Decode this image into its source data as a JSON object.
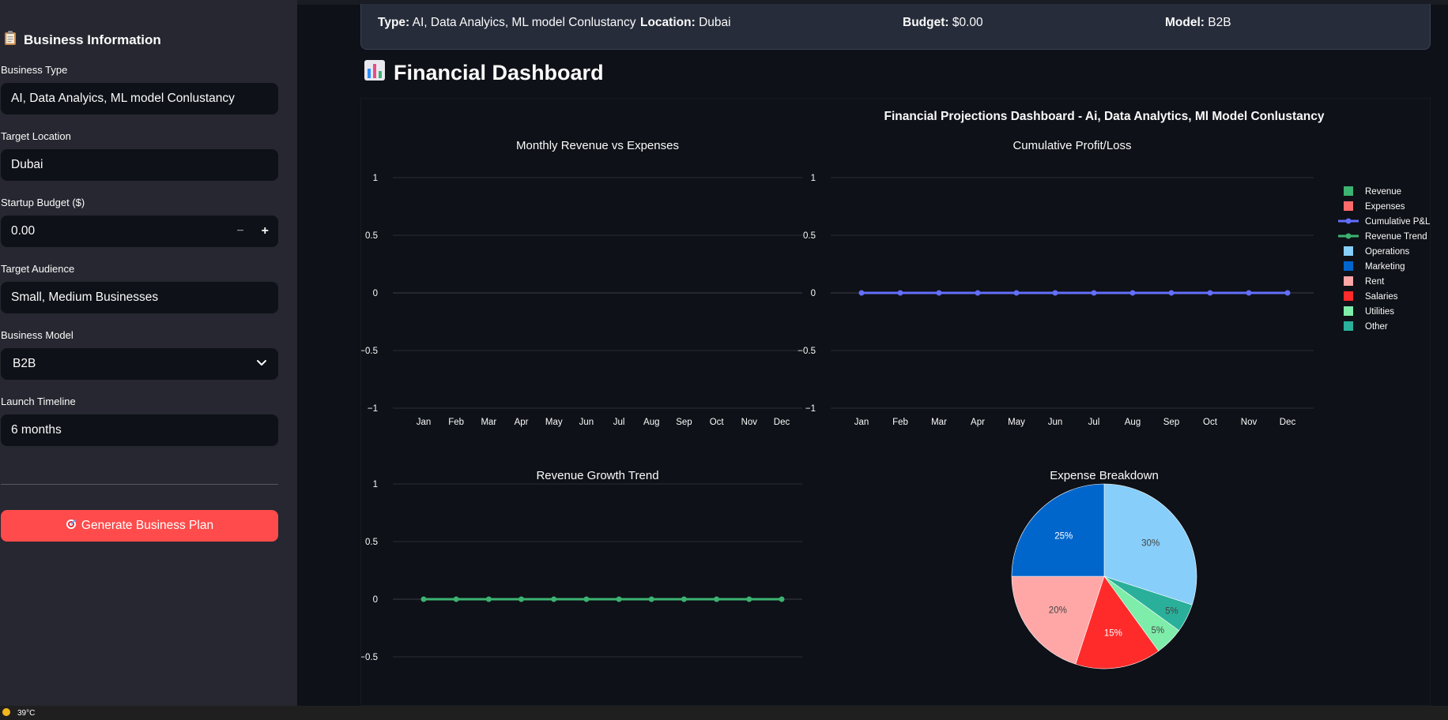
{
  "sidebar": {
    "section_title": "Business Information",
    "fields": {
      "business_type": {
        "label": "Business Type",
        "value": "AI, Data Analyics, ML model Conlustancy"
      },
      "target_location": {
        "label": "Target Location",
        "value": "Dubai"
      },
      "startup_budget": {
        "label": "Startup Budget ($)",
        "value": "0.00",
        "minus": "−",
        "plus": "+"
      },
      "target_audience": {
        "label": "Target Audience",
        "value": "Small, Medium Businesses"
      },
      "business_model": {
        "label": "Business Model",
        "value": "B2B"
      },
      "launch_timeline": {
        "label": "Launch Timeline",
        "value": "6 months"
      }
    },
    "generate_button": "Generate Business Plan"
  },
  "summary": {
    "type_label": "Type:",
    "type_value": "AI, Data Analyics, ML model Conlustancy",
    "location_label": "Location:",
    "location_value": "Dubai",
    "budget_label": "Budget:",
    "budget_value": "$0.00",
    "model_label": "Model:",
    "model_value": "B2B"
  },
  "dashboard": {
    "title": "Financial Dashboard"
  },
  "colors": {
    "accent_red": "#ff4b4b",
    "revenue": "#3cb371",
    "expenses": "#ff6b6b",
    "cumulative": "#636efa",
    "revenue_trend": "#3cb371",
    "operations": "#87cefa",
    "marketing": "#0066cc",
    "rent": "#ffa7a7",
    "salaries": "#ff2b2b",
    "utilities": "#7fedaa",
    "other": "#2ab09a"
  },
  "chart_data": {
    "suptitle": "Financial Projections Dashboard - Ai, Data Analytics, Ml Model Conlustancy",
    "legend": [
      "Revenue",
      "Expenses",
      "Cumulative P&L",
      "Revenue Trend",
      "Operations",
      "Marketing",
      "Rent",
      "Salaries",
      "Utilities",
      "Other"
    ],
    "charts": [
      {
        "title": "Monthly Revenue vs Expenses",
        "type": "bar",
        "categories": [
          "Jan",
          "Feb",
          "Mar",
          "Apr",
          "May",
          "Jun",
          "Jul",
          "Aug",
          "Sep",
          "Oct",
          "Nov",
          "Dec"
        ],
        "series": [
          {
            "name": "Revenue",
            "values": [
              0,
              0,
              0,
              0,
              0,
              0,
              0,
              0,
              0,
              0,
              0,
              0
            ]
          },
          {
            "name": "Expenses",
            "values": [
              0,
              0,
              0,
              0,
              0,
              0,
              0,
              0,
              0,
              0,
              0,
              0
            ]
          }
        ],
        "ylim": [
          -1,
          1
        ],
        "yticks": [
          "1",
          "0.5",
          "0",
          "−0.5",
          "−1"
        ]
      },
      {
        "title": "Cumulative Profit/Loss",
        "type": "line",
        "categories": [
          "Jan",
          "Feb",
          "Mar",
          "Apr",
          "May",
          "Jun",
          "Jul",
          "Aug",
          "Sep",
          "Oct",
          "Nov",
          "Dec"
        ],
        "series": [
          {
            "name": "Cumulative P&L",
            "values": [
              0,
              0,
              0,
              0,
              0,
              0,
              0,
              0,
              0,
              0,
              0,
              0
            ]
          }
        ],
        "ylim": [
          -1,
          1
        ],
        "yticks": [
          "1",
          "0.5",
          "0",
          "−0.5",
          "−1"
        ]
      },
      {
        "title": "Revenue Growth Trend",
        "type": "line",
        "categories": [
          "Jan",
          "Feb",
          "Mar",
          "Apr",
          "May",
          "Jun",
          "Jul",
          "Aug",
          "Sep",
          "Oct",
          "Nov",
          "Dec"
        ],
        "series": [
          {
            "name": "Revenue Trend",
            "values": [
              0,
              0,
              0,
              0,
              0,
              0,
              0,
              0,
              0,
              0,
              0,
              0
            ]
          }
        ],
        "ylim": [
          -1,
          1
        ],
        "yticks": [
          "1",
          "0.5",
          "0",
          "−0.5",
          "−1"
        ]
      },
      {
        "title": "Expense Breakdown",
        "type": "pie",
        "slices": [
          {
            "name": "Operations",
            "value": 30,
            "label": "30%"
          },
          {
            "name": "Other",
            "value": 5,
            "label": "5%"
          },
          {
            "name": "Utilities",
            "value": 5,
            "label": "5%"
          },
          {
            "name": "Salaries",
            "value": 15,
            "label": "15%"
          },
          {
            "name": "Rent",
            "value": 20,
            "label": "20%"
          },
          {
            "name": "Marketing",
            "value": 25,
            "label": "25%"
          }
        ]
      }
    ]
  },
  "taskbar": {
    "temperature": "39°C"
  }
}
